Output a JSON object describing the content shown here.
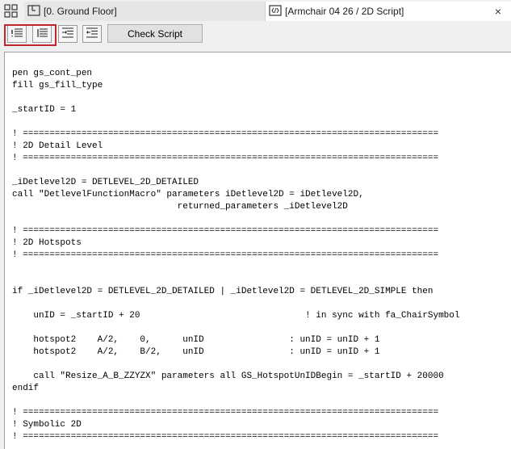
{
  "tabs": [
    {
      "label": "[0. Ground Floor]",
      "icon": "floor-plan-icon"
    },
    {
      "label": "[Armchair 04 26 / 2D Script]",
      "icon": "script-icon"
    }
  ],
  "close_label": "×",
  "toolbar": {
    "check_script_label": "Check Script",
    "buttons": [
      "comment-lines-icon",
      "uncomment-lines-icon",
      "indent-icon",
      "outdent-icon"
    ]
  },
  "highlight_color": "#c0262d",
  "code_lines": [
    "pen gs_cont_pen",
    "fill gs_fill_type",
    "",
    "_startID = 1",
    "",
    "! ==============================================================================",
    "! 2D Detail Level",
    "! ==============================================================================",
    "",
    "_iDetlevel2D = DETLEVEL_2D_DETAILED",
    "call \"DetlevelFunctionMacro\" parameters iDetlevel2D = iDetlevel2D,",
    "                               returned_parameters _iDetlevel2D",
    "",
    "! ==============================================================================",
    "! 2D Hotspots",
    "! ==============================================================================",
    "",
    "",
    "if _iDetlevel2D = DETLEVEL_2D_DETAILED | _iDetlevel2D = DETLEVEL_2D_SIMPLE then",
    "",
    "    unID = _startID + 20                               ! in sync with fa_ChairSymbol",
    "",
    "    hotspot2    A/2,    0,      unID                : unID = unID + 1",
    "    hotspot2    A/2,    B/2,    unID                : unID = unID + 1",
    "",
    "    call \"Resize_A_B_ZZYZX\" parameters all GS_HotspotUnIDBegin = _startID + 20000",
    "endif",
    "",
    "! ==============================================================================",
    "! Symbolic 2D",
    "! =============================================================================="
  ]
}
